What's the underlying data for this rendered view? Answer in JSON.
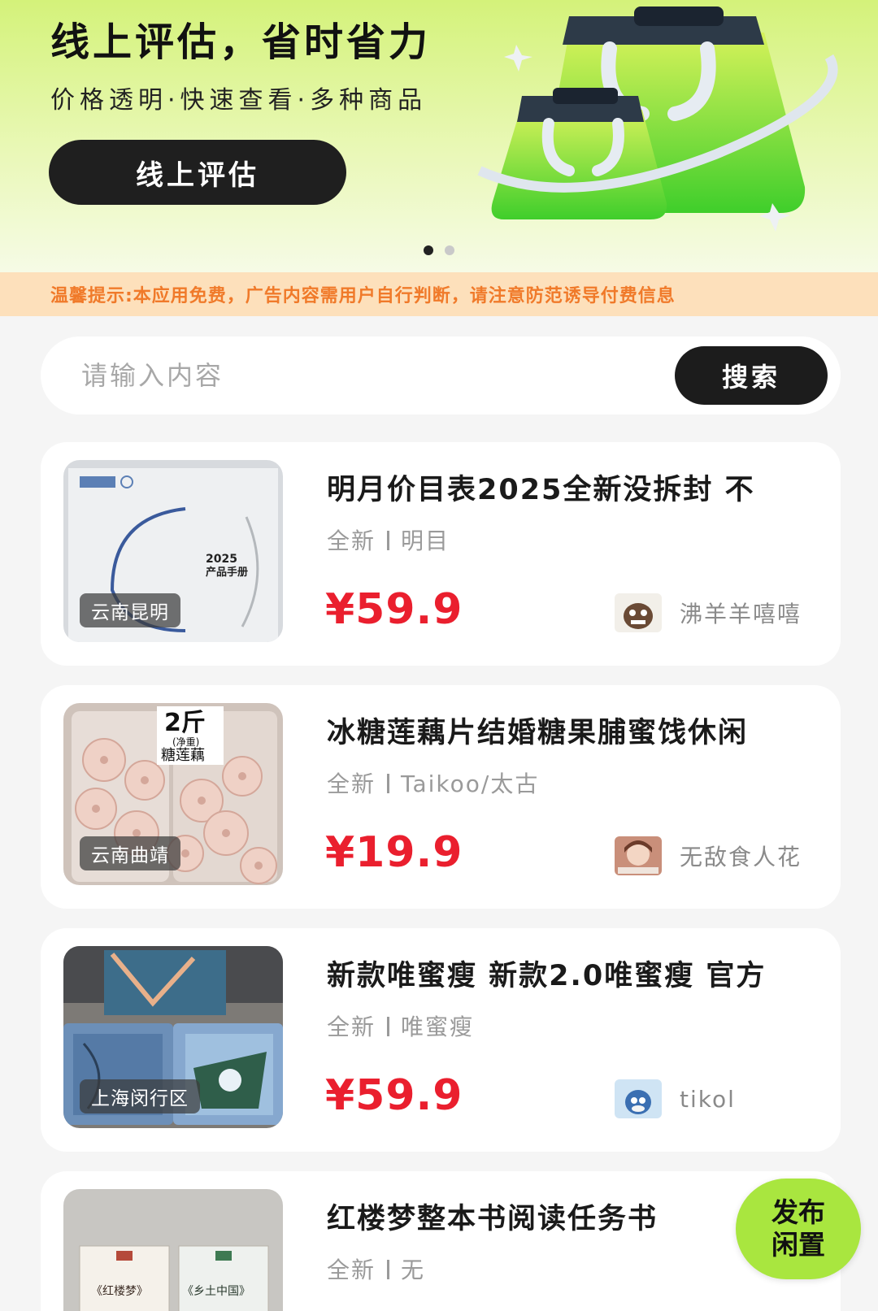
{
  "banner": {
    "title": "线上评估，省时省力",
    "subtitle": "价格透明·快速查看·多种商品",
    "button_label": "线上评估"
  },
  "notice": "温馨提示:本应用免费，广告内容需用户自行判断，请注意防范诱导付费信息",
  "search": {
    "placeholder": "请输入内容",
    "button_label": "搜索"
  },
  "products": [
    {
      "title": "明月价目表2025全新没拆封 不",
      "condition": "全新",
      "brand": "明目",
      "price": "¥59.9",
      "location": "云南昆明",
      "seller": "沸羊羊嘻嘻",
      "thumb_text": [
        "2025",
        "产品手册"
      ]
    },
    {
      "title": "冰糖莲藕片结婚糖果脯蜜饯休闲",
      "condition": "全新",
      "brand": "Taikoo/太古",
      "price": "¥19.9",
      "location": "云南曲靖",
      "seller": "无敌食人花",
      "thumb_text": [
        "2斤",
        "(净重)",
        "糖莲藕"
      ]
    },
    {
      "title": "新款唯蜜瘦 新款2.0唯蜜瘦 官方",
      "condition": "全新",
      "brand": "唯蜜瘦",
      "price": "¥59.9",
      "location": "上海闵行区",
      "seller": "tikol",
      "thumb_text": []
    },
    {
      "title": "红楼梦整本书阅读任务书",
      "condition": "全新",
      "brand": "无",
      "price": "",
      "location": "",
      "seller": "",
      "thumb_text": [
        "《红楼梦》",
        "《乡土中国》"
      ]
    }
  ],
  "fab": {
    "line1": "发布",
    "line2": "闲置"
  },
  "colors": {
    "accent_green": "#a9e63f",
    "price_red": "#ea1f2e",
    "notice_orange": "#f07a2a"
  },
  "carousel": {
    "total": 2,
    "active": 1
  }
}
